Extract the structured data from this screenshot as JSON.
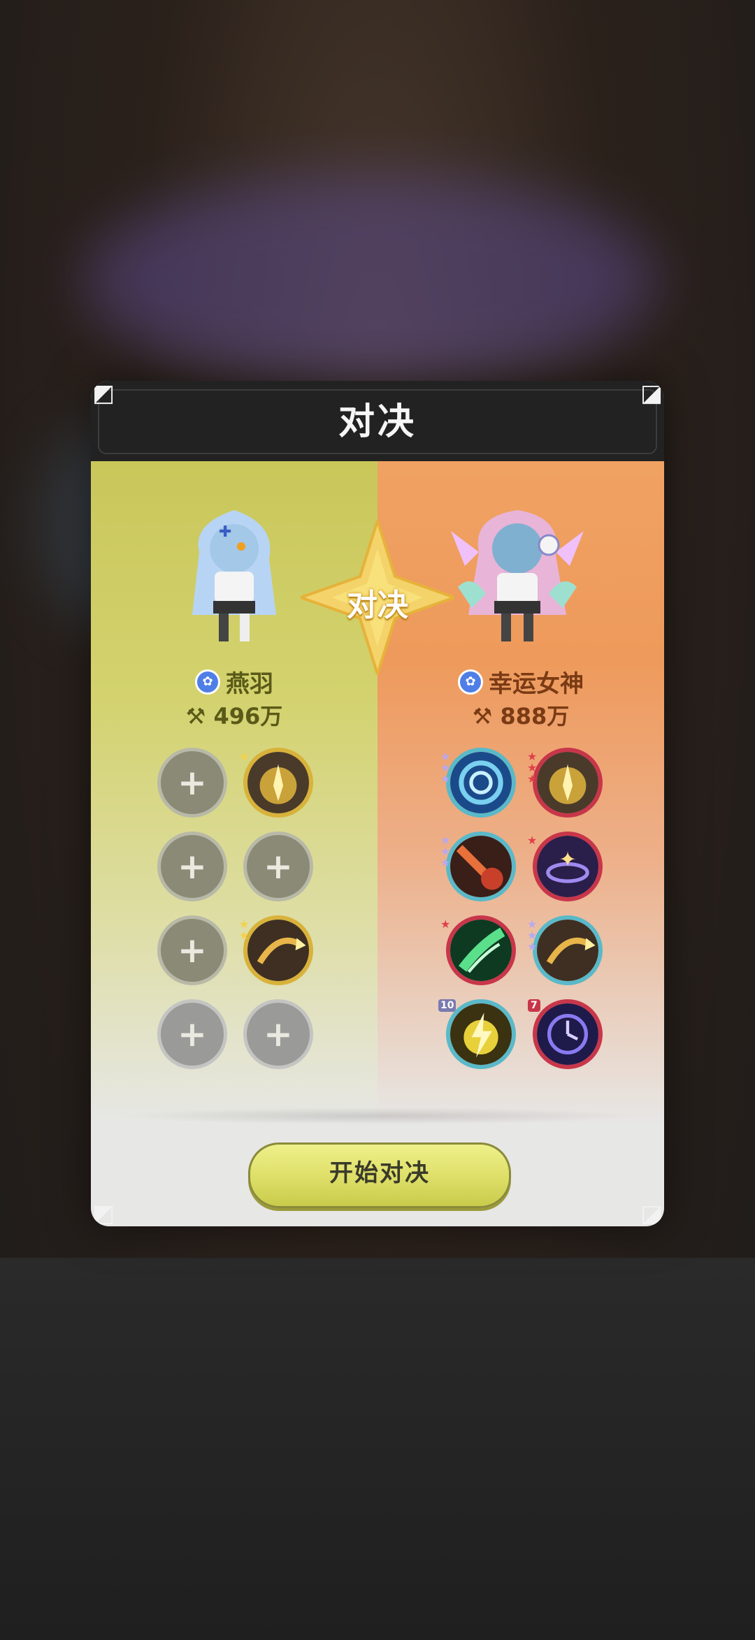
{
  "dialog": {
    "title": "对决",
    "vs_label": "对决",
    "start_button": "开始对决"
  },
  "left_player": {
    "name": "燕羽",
    "power": "496万",
    "skills": [
      {
        "state": "empty",
        "label": "+"
      },
      {
        "state": "equipped",
        "icon": "golden-burst-skill-icon",
        "stars": 1
      },
      {
        "state": "empty",
        "label": "+"
      },
      {
        "state": "empty",
        "label": "+"
      },
      {
        "state": "empty",
        "label": "+"
      },
      {
        "state": "equipped",
        "icon": "golden-arrow-skill-icon",
        "stars": 2
      },
      {
        "state": "empty",
        "label": "+"
      },
      {
        "state": "empty",
        "label": "+"
      }
    ]
  },
  "right_player": {
    "name": "幸运女神",
    "power": "888万",
    "skills": [
      {
        "icon": "blue-vortex-skill-icon",
        "stars": 3
      },
      {
        "icon": "golden-burst-skill-icon",
        "stars": 3
      },
      {
        "icon": "meteor-skill-icon",
        "stars": 3
      },
      {
        "icon": "purple-star-skill-icon",
        "stars": 1
      },
      {
        "icon": "green-wind-skill-icon",
        "stars": 1
      },
      {
        "icon": "golden-arrow-skill-icon",
        "stars": 3
      },
      {
        "icon": "yellow-lightning-skill-icon",
        "level": "10"
      },
      {
        "icon": "purple-clock-skill-icon",
        "level": "7"
      }
    ]
  },
  "colors": {
    "left_panel": "#c9c75a",
    "right_panel": "#f0a262",
    "header": "#222222",
    "button": "#dfe06a"
  }
}
